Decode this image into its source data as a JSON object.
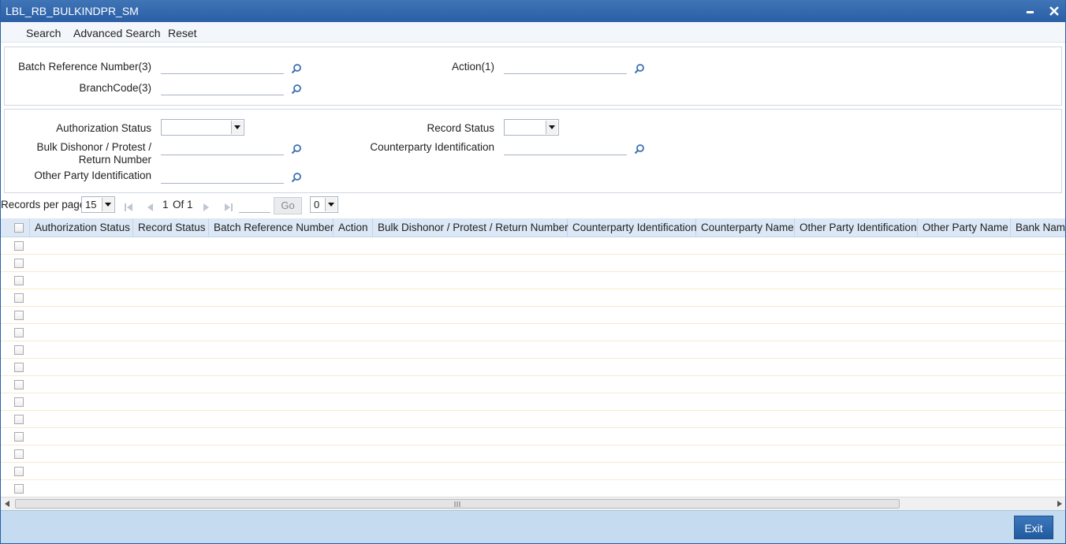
{
  "window": {
    "title": "LBL_RB_BULKINDPR_SM",
    "minimize_glyph": "▬",
    "close_glyph": "✕"
  },
  "menu": {
    "search": "Search",
    "advanced_search": "Advanced Search",
    "reset": "Reset"
  },
  "search_panel": {
    "batch_ref_label": "Batch Reference Number(3)",
    "action_label": "Action(1)",
    "branch_code_label": "BranchCode(3)"
  },
  "filter_panel": {
    "auth_status_label": "Authorization Status",
    "record_status_label": "Record Status",
    "bulk_dishonor_label_line1": "Bulk Dishonor / Protest /",
    "bulk_dishonor_label_line2": "Return Number",
    "counterparty_label": "Counterparty Identification",
    "other_party_label": "Other Party Identification"
  },
  "pager": {
    "records_per_page_label": "Records per page",
    "records_per_page_value": "15",
    "current_page": "1",
    "of_label": "Of",
    "total_pages": "1",
    "go_label": "Go",
    "right_select_value": "0"
  },
  "grid": {
    "columns": [
      "Authorization Status",
      "Record Status",
      "Batch Reference Number",
      "Action",
      "Bulk Dishonor / Protest / Return Number",
      "Counterparty Identification",
      "Counterparty Name",
      "Other Party Identification",
      "Other Party Name",
      "Bank Name"
    ],
    "row_count": 15
  },
  "footer": {
    "exit_label": "Exit"
  },
  "colors": {
    "title_bar": "#2b5fa6",
    "header_row": "#dce8f5",
    "footer": "#c5dcf0",
    "exit_button": "#2f6aae"
  }
}
